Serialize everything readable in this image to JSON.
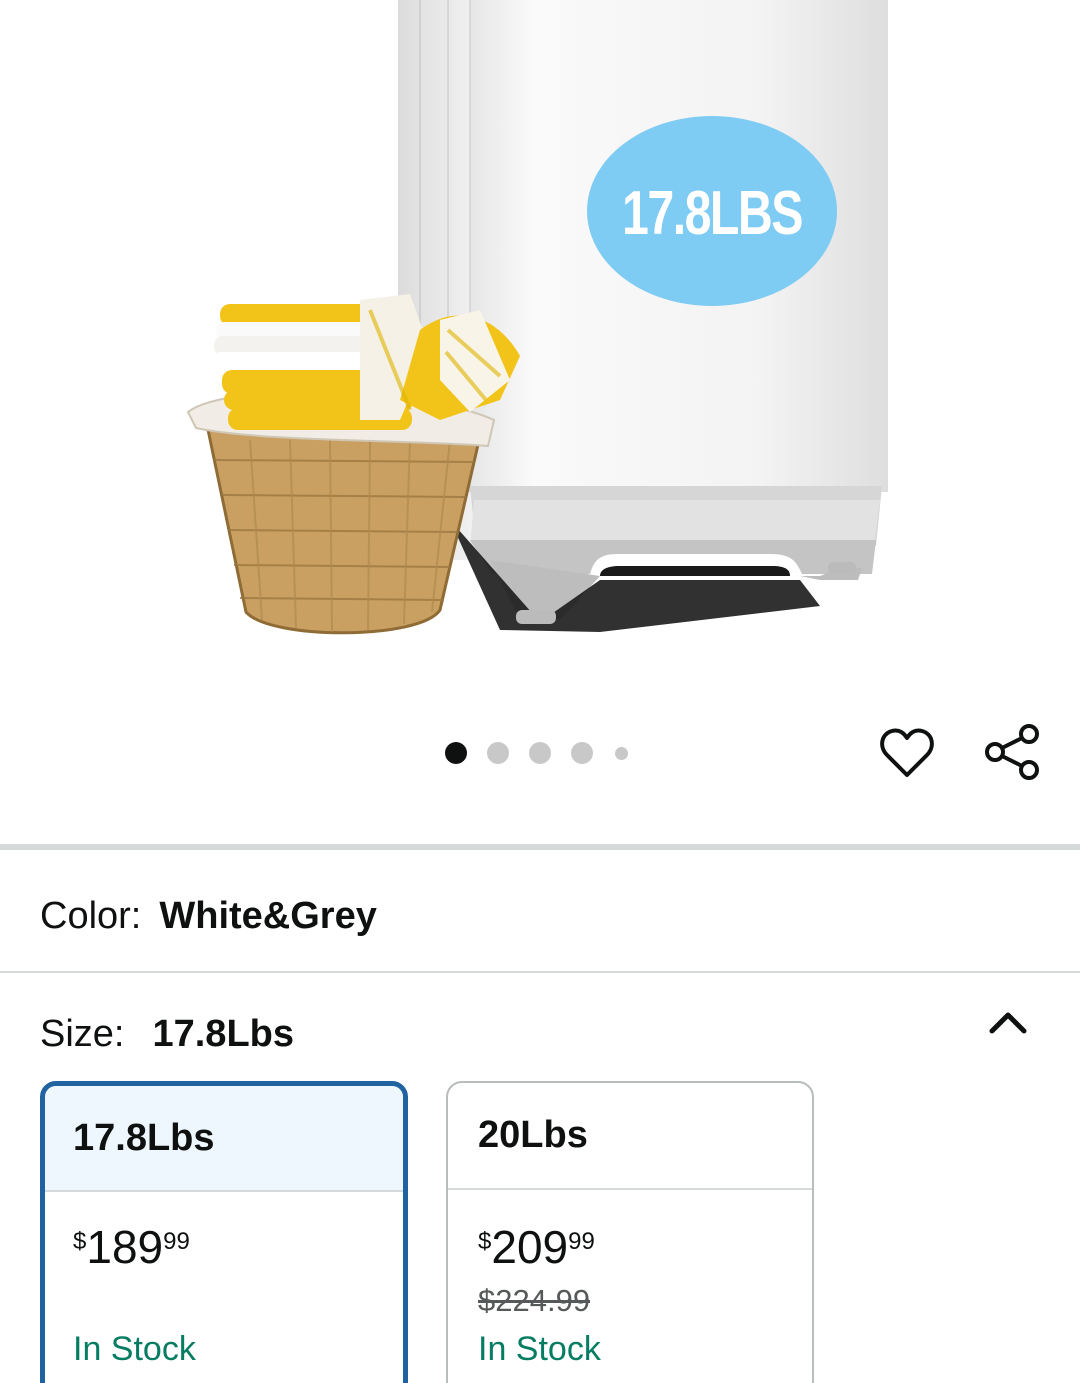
{
  "product_image": {
    "badge_text": "17.8LBS",
    "colors": {
      "badge": "#7ecbf4",
      "washer_body": "#f4f4f4",
      "washer_base": "#c9c9c9",
      "basket": "#c9a062",
      "towel_yellow": "#f2c318"
    }
  },
  "carousel": {
    "total_dots": 5,
    "active_index": 0
  },
  "actions": {
    "favorite_icon": "heart-icon",
    "share_icon": "share-icon"
  },
  "color": {
    "label": "Color:",
    "value": "White&Grey"
  },
  "size": {
    "label": "Size:",
    "value": "17.8Lbs",
    "collapse_icon": "chevron-up-icon",
    "options": [
      {
        "name": "17.8Lbs",
        "currency": "$",
        "price_whole": "189",
        "price_fraction": "99",
        "list_price": "",
        "stock": "In Stock",
        "selected": true
      },
      {
        "name": "20Lbs",
        "currency": "$",
        "price_whole": "209",
        "price_fraction": "99",
        "list_price": "$224.99",
        "stock": "In Stock",
        "selected": false
      }
    ]
  },
  "theme": {
    "accent": "#2162a1",
    "stock_green": "#067d62",
    "selected_bg": "#edf7fd"
  }
}
